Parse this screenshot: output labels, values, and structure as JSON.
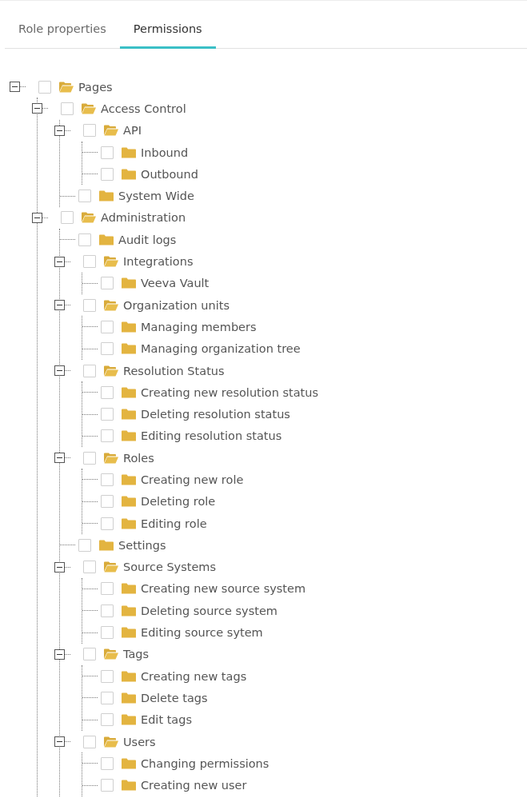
{
  "tabs": [
    {
      "label": "Role properties",
      "selected": false
    },
    {
      "label": "Permissions",
      "selected": true
    }
  ],
  "tree": [
    {
      "label": "Pages",
      "checked": false,
      "expanded": true,
      "children": [
        {
          "label": "Access Control",
          "checked": false,
          "expanded": true,
          "children": [
            {
              "label": "API",
              "checked": false,
              "expanded": true,
              "children": [
                {
                  "label": "Inbound",
                  "checked": false
                },
                {
                  "label": "Outbound",
                  "checked": false
                }
              ]
            },
            {
              "label": "System Wide",
              "checked": false
            }
          ]
        },
        {
          "label": "Administration",
          "checked": false,
          "expanded": true,
          "children": [
            {
              "label": "Audit logs",
              "checked": false
            },
            {
              "label": "Integrations",
              "checked": false,
              "expanded": true,
              "children": [
                {
                  "label": "Veeva Vault",
                  "checked": false
                }
              ]
            },
            {
              "label": "Organization units",
              "checked": false,
              "expanded": true,
              "children": [
                {
                  "label": "Managing members",
                  "checked": false
                },
                {
                  "label": "Managing organization tree",
                  "checked": false
                }
              ]
            },
            {
              "label": "Resolution Status",
              "checked": false,
              "expanded": true,
              "children": [
                {
                  "label": "Creating new resolution status",
                  "checked": false
                },
                {
                  "label": "Deleting resolution status",
                  "checked": false
                },
                {
                  "label": "Editing resolution status",
                  "checked": false
                }
              ]
            },
            {
              "label": "Roles",
              "checked": false,
              "expanded": true,
              "children": [
                {
                  "label": "Creating new role",
                  "checked": false
                },
                {
                  "label": "Deleting role",
                  "checked": false
                },
                {
                  "label": "Editing role",
                  "checked": false
                }
              ]
            },
            {
              "label": "Settings",
              "checked": false
            },
            {
              "label": "Source Systems",
              "checked": false,
              "expanded": true,
              "children": [
                {
                  "label": "Creating new source system",
                  "checked": false
                },
                {
                  "label": "Deleting source system",
                  "checked": false
                },
                {
                  "label": "Editing source sytem",
                  "checked": false
                }
              ]
            },
            {
              "label": "Tags",
              "checked": false,
              "expanded": true,
              "children": [
                {
                  "label": "Creating new tags",
                  "checked": false
                },
                {
                  "label": "Delete tags",
                  "checked": false
                },
                {
                  "label": "Edit tags",
                  "checked": false
                }
              ]
            },
            {
              "label": "Users",
              "checked": false,
              "expanded": true,
              "children": [
                {
                  "label": "Changing permissions",
                  "checked": false
                },
                {
                  "label": "Creating new user",
                  "checked": false
                }
              ]
            }
          ]
        }
      ]
    }
  ]
}
